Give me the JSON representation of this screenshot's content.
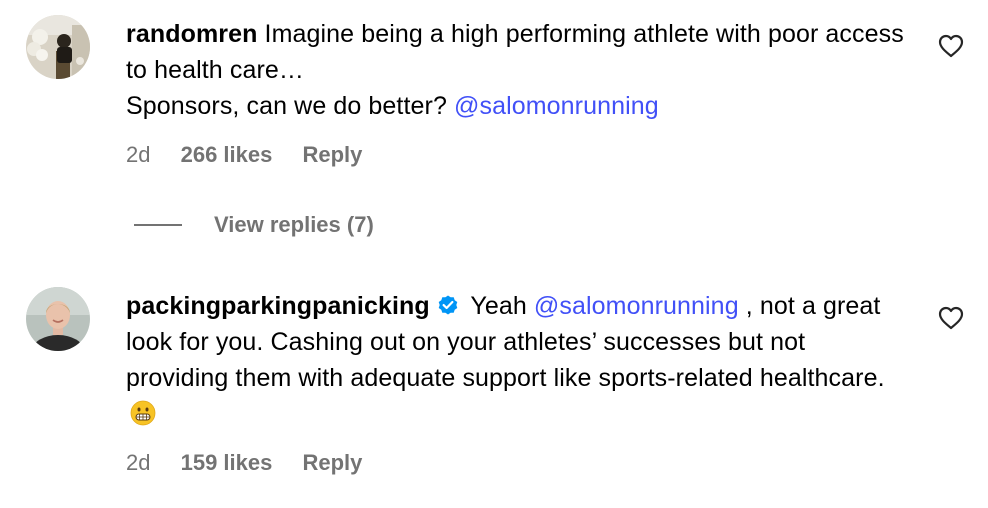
{
  "comments": [
    {
      "username": "randomren",
      "text_before": "Imagine being a high performing athlete with poor access to health care…",
      "text_line2": "Sponsors, can we do better?",
      "mention": "@salomonrunning",
      "time": "2d",
      "likes": "266 likes",
      "reply": "Reply",
      "view_replies": "View replies (7)",
      "avatar_icon": "avatar-photo-person-flowers",
      "like_icon": "heart-outline-icon"
    },
    {
      "username": "packingparkingpanicking",
      "verified_icon": "verified-badge-icon",
      "text_pre_mention": "Yeah",
      "mention": "@salomonrunning",
      "text_after_mention": ", not a great look for you. Cashing out on your athletes’ successes but not providing them with adequate support like sports-related healthcare.",
      "emoji": "grimacing-face-emoji",
      "time": "2d",
      "likes": "159 likes",
      "reply": "Reply",
      "avatar_icon": "avatar-photo-person",
      "like_icon": "heart-outline-icon"
    }
  ],
  "colors": {
    "mention": "#4150f7",
    "meta": "#737373",
    "verified": "#0095f6"
  }
}
